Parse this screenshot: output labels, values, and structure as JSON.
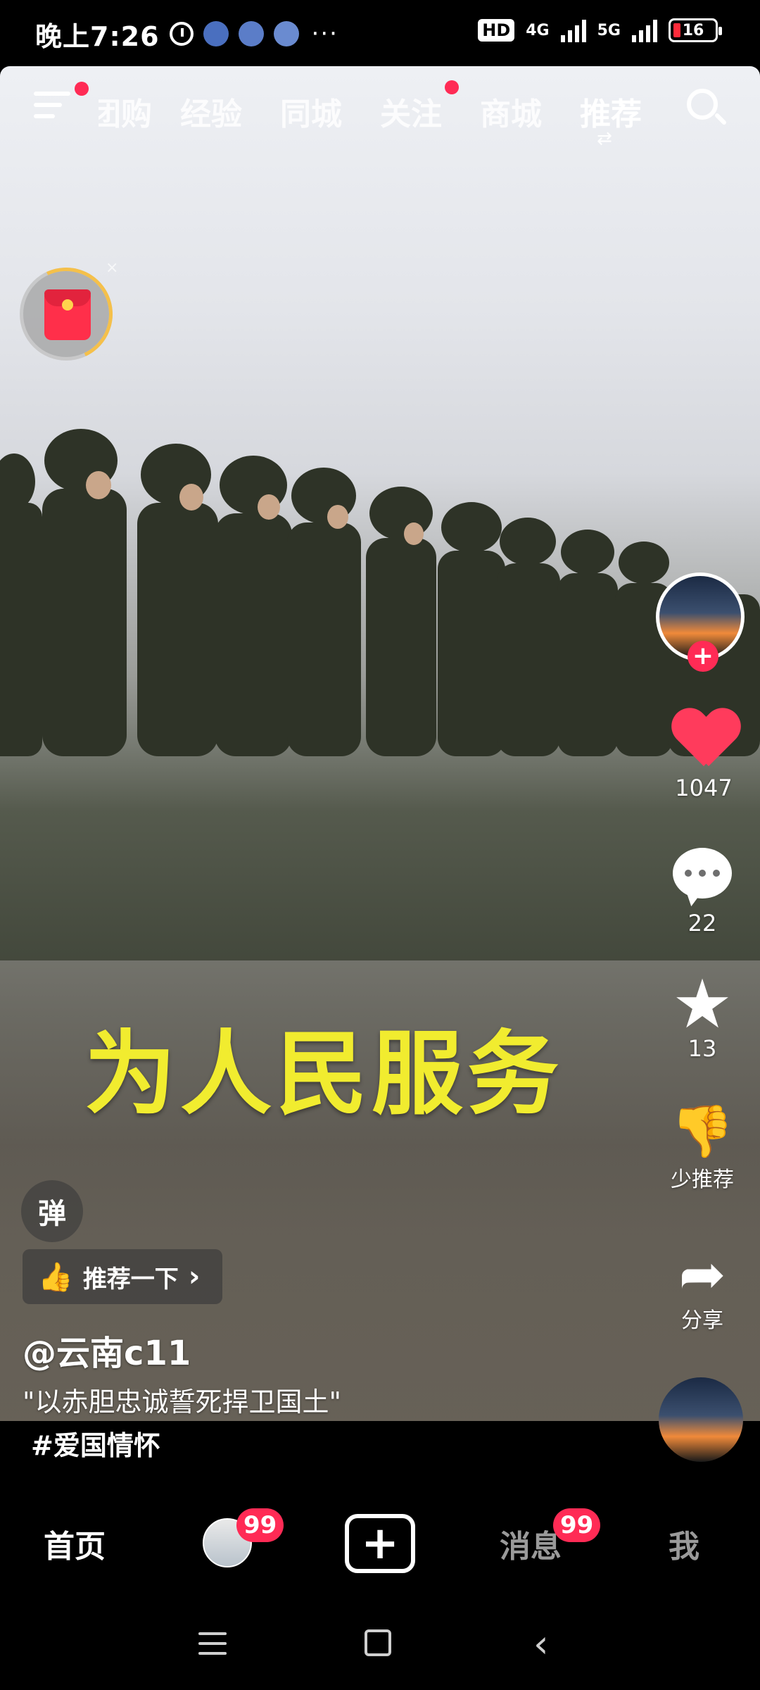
{
  "status_bar": {
    "time": "晚上7:26",
    "more": "···",
    "hd_label": "HD",
    "network_1": "4G",
    "network_2": "5G",
    "battery": "16"
  },
  "top_nav": {
    "tabs": [
      {
        "label": "团购"
      },
      {
        "label": "经验"
      },
      {
        "label": "同城"
      },
      {
        "label": "关注"
      },
      {
        "label": "商城"
      },
      {
        "label": "推荐"
      }
    ],
    "swap_icon": "⇄"
  },
  "red_packet": {
    "close": "×"
  },
  "video": {
    "caption": "为人民服务"
  },
  "actions": {
    "like_count": "1047",
    "comment_count": "22",
    "favorite_count": "13",
    "dislike_label": "少推荐",
    "share_label": "分享"
  },
  "post": {
    "danmu_label": "弹",
    "recommend_label": "推荐一下",
    "recommend_arrow": "›",
    "author": "@云南c11",
    "description": "\"以赤胆忠诚誓死捍卫国土\"",
    "hashtag": "#爱国情怀"
  },
  "bottom_tabs": {
    "home": "首页",
    "friends_badge": "99",
    "create": "+",
    "messages": "消息",
    "messages_badge": "99",
    "me": "我"
  },
  "colors": {
    "accent": "#ff2b55",
    "caption": "#f1ec2f",
    "like": "#ff3b5c"
  }
}
